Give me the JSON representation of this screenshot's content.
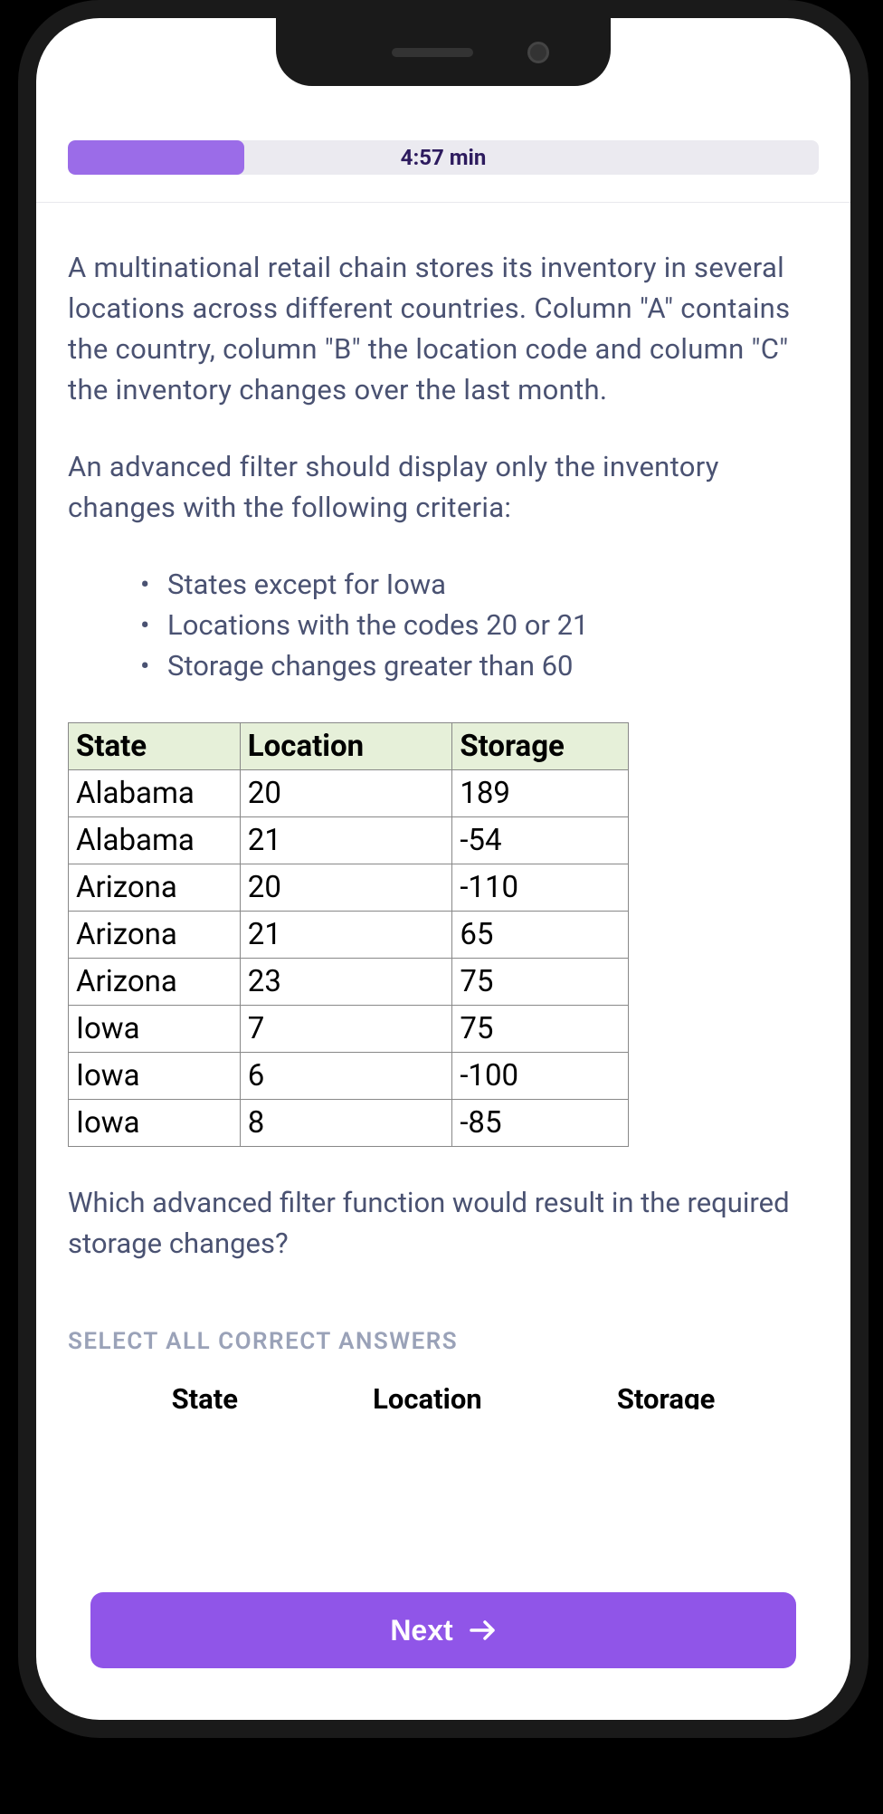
{
  "timer": "4:57 min",
  "question": {
    "intro": "A multinational retail chain stores its inventory in several locations across different countries. Column \"A\" contains the country, column \"B\" the location code and column \"C\" the inventory changes over the last month.",
    "filter_intro": "An advanced filter should display only the inventory changes with the following criteria:",
    "criteria": [
      "States except for Iowa",
      "Locations with the codes 20 or 21",
      "Storage changes greater than 60"
    ],
    "followup": "Which advanced filter function would result in the required storage changes?"
  },
  "table": {
    "headers": [
      "State",
      "Location",
      "Storage"
    ],
    "rows": [
      [
        "Alabama",
        "20",
        "189"
      ],
      [
        "Alabama",
        "21",
        "-54"
      ],
      [
        "Arizona",
        "20",
        "-110"
      ],
      [
        "Arizona",
        "21",
        "65"
      ],
      [
        "Arizona",
        "23",
        "75"
      ],
      [
        "Iowa",
        "7",
        "75"
      ],
      [
        "Iowa",
        "6",
        "-100"
      ],
      [
        "Iowa",
        "8",
        "-85"
      ]
    ]
  },
  "instruction": "SELECT ALL CORRECT ANSWERS",
  "answer_preview": {
    "col1": "State",
    "col2": "Location",
    "col3": "Storage"
  },
  "next_button": "Next"
}
